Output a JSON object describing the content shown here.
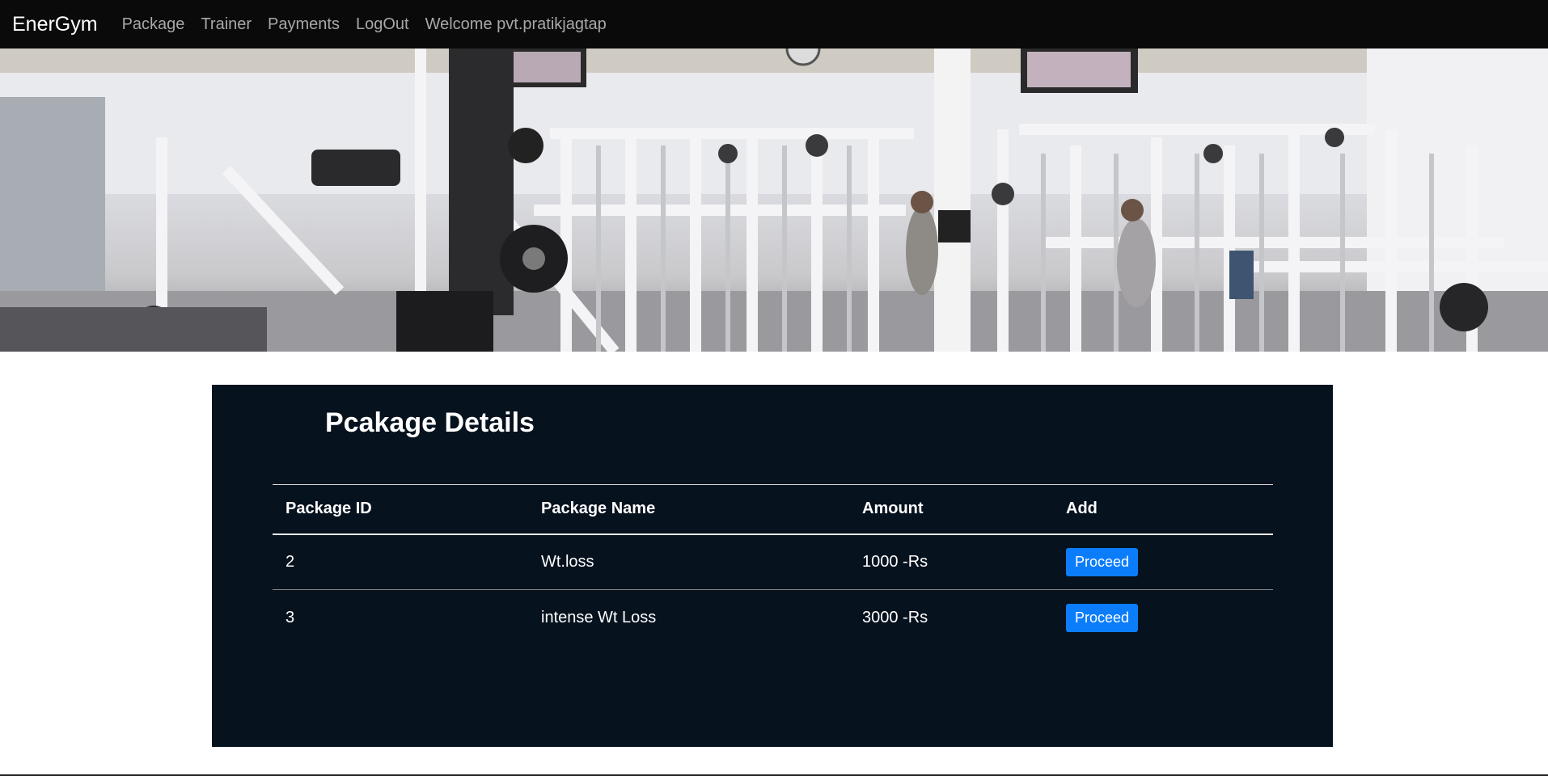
{
  "navbar": {
    "brand": "EnerGym",
    "links": [
      {
        "label": "Package"
      },
      {
        "label": "Trainer"
      },
      {
        "label": "Payments"
      },
      {
        "label": "LogOut"
      }
    ],
    "welcome": "Welcome pvt.pratikjagtap"
  },
  "hero": {
    "description_image": "gym-equipment-photo"
  },
  "panel": {
    "title": "Pcakage Details",
    "table": {
      "headers": [
        "Package ID",
        "Package Name",
        "Amount",
        "Add"
      ],
      "rows": [
        {
          "id": "2",
          "name": "Wt.loss",
          "amount": "1000 -Rs",
          "action": "Proceed"
        },
        {
          "id": "3",
          "name": "intense Wt Loss",
          "amount": "3000 -Rs",
          "action": "Proceed"
        }
      ]
    }
  },
  "colors": {
    "navbar_bg": "#0a0a0a",
    "panel_bg": "#06121e",
    "button_bg": "#0b7dfb"
  }
}
